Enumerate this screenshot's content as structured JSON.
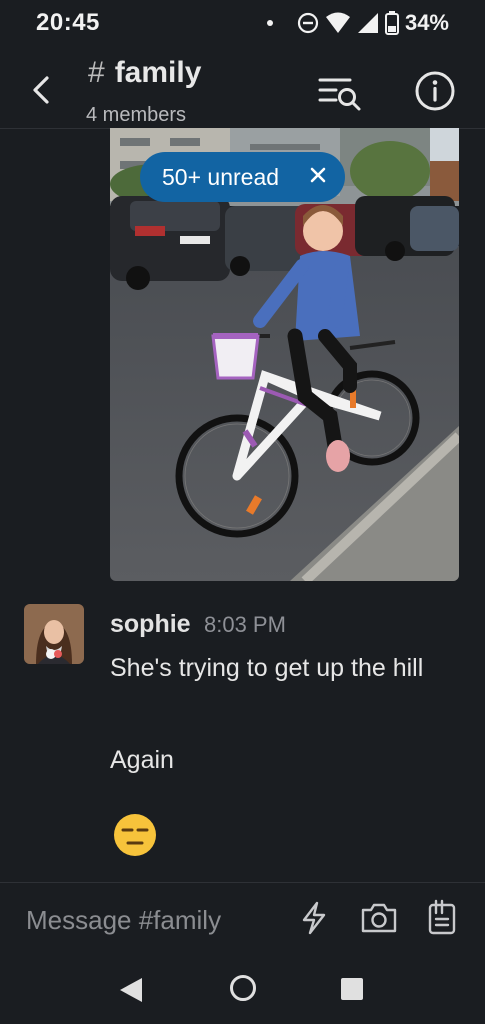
{
  "status_bar": {
    "time": "20:45",
    "battery": "34%"
  },
  "header": {
    "channel_name": "family",
    "members": "4 members"
  },
  "unread_pill": {
    "label": "50+ unread"
  },
  "message": {
    "author": "sophie",
    "time": "8:03 PM",
    "lines": [
      "She's trying to get up the hill",
      "Again"
    ],
    "emoji": "expressionless-face"
  },
  "composer": {
    "placeholder": "Message #family"
  },
  "colors": {
    "background": "#1a1d21",
    "unread_pill": "#1264a3",
    "emoji": "#f7c33b"
  },
  "icons": [
    "back-icon",
    "search-messages-icon",
    "info-icon",
    "close-icon",
    "lightning-icon",
    "camera-icon",
    "attachment-icon",
    "nav-back-icon",
    "nav-home-icon",
    "nav-recents-icon"
  ]
}
